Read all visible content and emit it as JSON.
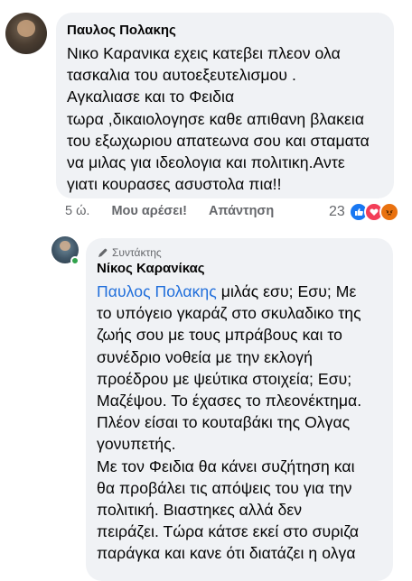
{
  "comment": {
    "author": "Παυλος Πολακης",
    "lines": [
      "Νικο Καρανικα εχεις κατεβει πλεον ολα",
      "τασκαλια του αυτοεξευτελισμου .",
      "Αγκαλιασε και το Φειδια",
      "τωρα ,δικαιολογησε καθε απιθανη βλακεια",
      "του εξωχωριου απατεωνα σου και σταματα",
      "να μιλας για ιδεολογια και πολιτικη.Αντε",
      "γιατι κουρασες ασυστολα πια!!"
    ],
    "time": "5 ώ.",
    "like_label": "Μου αρέσει!",
    "reply_label": "Απάντηση",
    "reaction_count": "23",
    "reaction_icons": [
      "like-icon",
      "love-icon",
      "angry-icon"
    ]
  },
  "reply": {
    "badge": "Συντάκτης",
    "author": "Νίκος Καρανίκας",
    "mention": "Παυλος Πολακης",
    "first_line_rest": " μιλάς εσυ; Εσυ; Με",
    "lines": [
      "το υπόγειο γκαράζ στο σκυλαδικο της",
      "ζωής σου με τους μπράβους και το",
      "συνέδριο νοθεία με την εκλογή",
      "προέδρου με ψεύτικα στοιχεία; Εσυ;",
      "Μαζέψου. Το έχασες το πλεονέκτημα.",
      "Πλέον είσαι το κουταβάκι της Ολγας",
      "γονυπετής.",
      "Με τον Φειδια θα κάνει συζήτηση και",
      "θα προβάλει τις απόψεις του για την",
      "πολιτική. Βιαστηκες αλλά δεν",
      "πειράζει. Τώρα κάτσε εκεί στο συριζα",
      "παράγκα και κανε ότι διατάζει η ολγα"
    ]
  },
  "colors": {
    "bubble": "#f0f2f5",
    "mention": "#216fdb",
    "secondary_text": "#65676b",
    "online": "#31a24c"
  }
}
